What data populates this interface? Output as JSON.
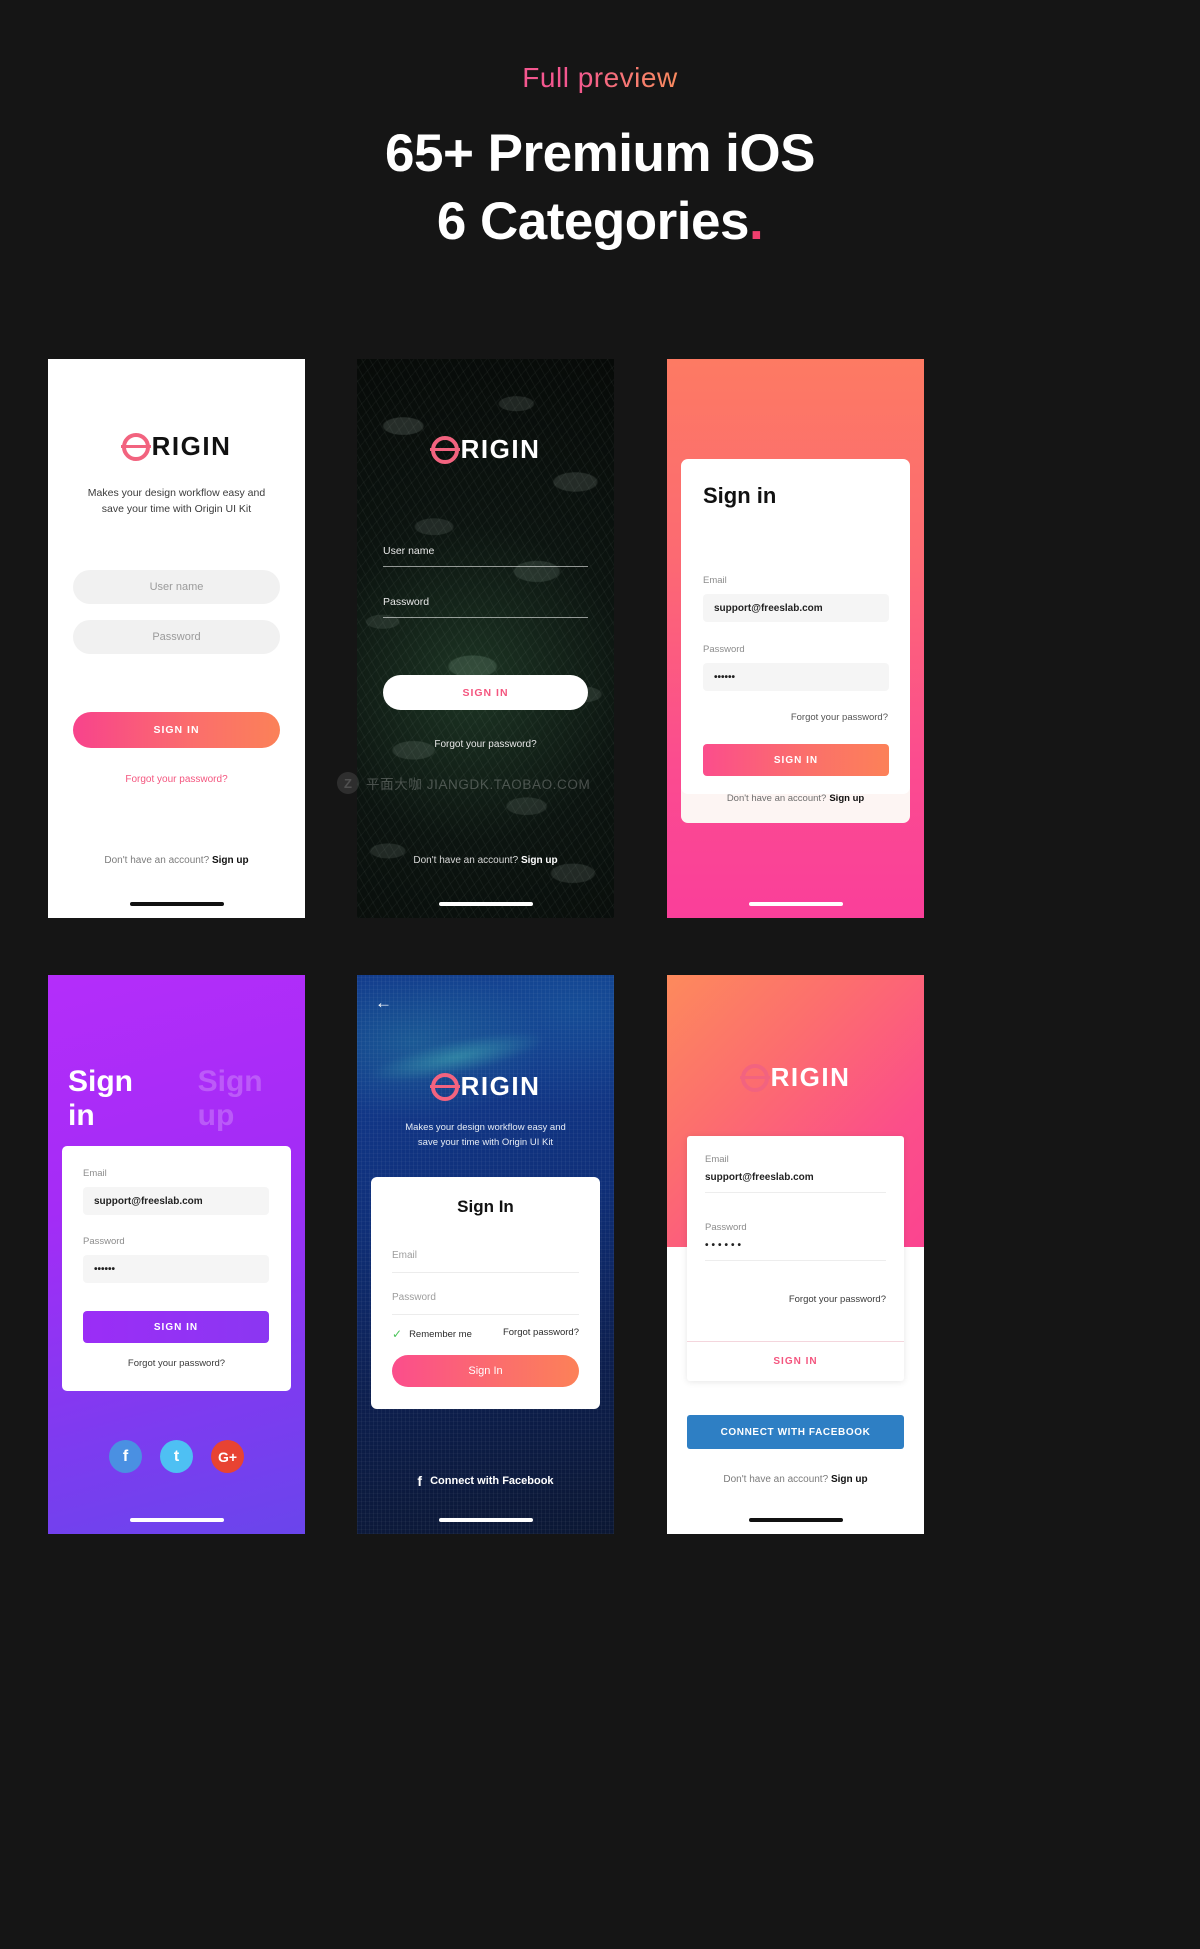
{
  "header": {
    "eyebrow": "Full preview",
    "line1": "65+ Premium iOS",
    "line2": "6 Categories",
    "dot": "."
  },
  "colors": {
    "background": "#151515",
    "accent_pink": "#f4567f",
    "accent_coral": "#fb8158",
    "accent_purple": "#a42cf6",
    "accent_blue": "#2e7fc4",
    "accent_green": "#4cc45a"
  },
  "brand": {
    "name": "RIGIN",
    "full": "ORIGIN"
  },
  "watermark": {
    "badge": "Z",
    "text": "平面大咖  JIANGDK.TAOBAO.COM"
  },
  "screens": [
    {
      "id": "signin-white",
      "tagline_line1": "Makes your design workflow easy and",
      "tagline_line2": "save your time with Origin UI Kit",
      "username_placeholder": "User name",
      "password_placeholder": "Password",
      "signin_label": "SIGN IN",
      "forgot_label": "Forgot your password?",
      "footer_prefix": "Don't have an account?",
      "footer_link": "Sign up"
    },
    {
      "id": "signin-leaves",
      "username_label": "User name",
      "password_label": "Password",
      "signin_label": "SIGN IN",
      "forgot_label": "Forgot your password?",
      "footer_prefix": "Don't have an account?",
      "footer_link": "Sign up"
    },
    {
      "id": "signin-coral-card",
      "title": "Sign in",
      "email_label": "Email",
      "email_value": "support@freeslab.com",
      "password_label": "Password",
      "password_value": "••••••",
      "forgot_label": "Forgot your password?",
      "signin_label": "SIGN IN",
      "footer_prefix": "Don't have an account?",
      "footer_link": "Sign up"
    },
    {
      "id": "signin-purple",
      "tab_active": "Sign in",
      "tab_inactive": "Sign up",
      "email_label": "Email",
      "email_value": "support@freeslab.com",
      "password_label": "Password",
      "password_value": "••••••",
      "signin_label": "SIGN IN",
      "forgot_label": "Forgot your password?",
      "social": [
        {
          "name": "facebook",
          "glyph": "f"
        },
        {
          "name": "twitter",
          "glyph": "t"
        },
        {
          "name": "google-plus",
          "glyph": "G+"
        }
      ]
    },
    {
      "id": "signin-blue",
      "back_icon": "←",
      "tagline_line1": "Makes your design workflow easy and",
      "tagline_line2": "save your time with Origin UI Kit",
      "title": "Sign In",
      "email_placeholder": "Email",
      "password_placeholder": "Password",
      "remember_label": "Remember me",
      "forgot_label": "Forgot password?",
      "signin_label": "Sign In",
      "facebook_label": "Connect with Facebook",
      "facebook_glyph": "f"
    },
    {
      "id": "signin-coral-facebook",
      "email_label": "Email",
      "email_value": "support@freeslab.com",
      "password_label": "Password",
      "password_value": "••••••",
      "forgot_label": "Forgot your password?",
      "signin_label": "SIGN IN",
      "facebook_label": "CONNECT WITH FACEBOOK",
      "footer_prefix": "Don't have an account?",
      "footer_link": "Sign up"
    }
  ]
}
